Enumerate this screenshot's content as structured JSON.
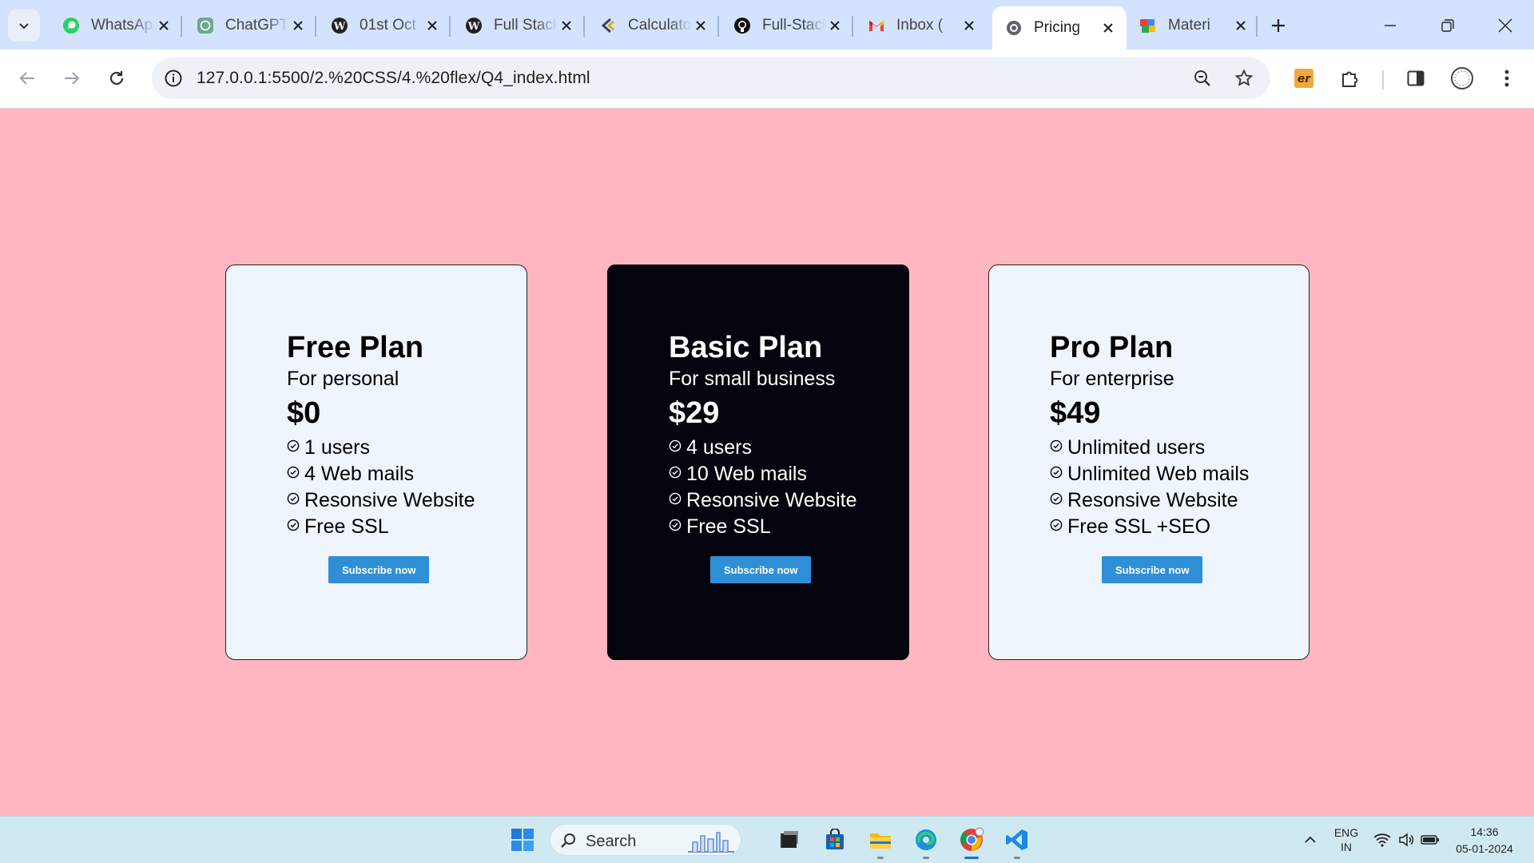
{
  "browser": {
    "tabs": [
      {
        "title": "WhatsApp",
        "icon": "whatsapp-icon",
        "active": false
      },
      {
        "title": "ChatGPT",
        "icon": "chatgpt-icon",
        "active": false
      },
      {
        "title": "01st Oct",
        "icon": "wordpress-icon",
        "active": false
      },
      {
        "title": "Full Stack",
        "icon": "wordpress-icon",
        "active": false
      },
      {
        "title": "Calculator",
        "icon": "calculator-icon",
        "active": false
      },
      {
        "title": "Full-Stack",
        "icon": "github-icon",
        "active": false
      },
      {
        "title": "Inbox (",
        "icon": "gmail-icon",
        "active": false
      },
      {
        "title": "Pricing",
        "icon": "globe-icon",
        "active": true
      },
      {
        "title": "Materi",
        "icon": "material-icon",
        "active": false
      }
    ],
    "url": "127.0.0.1:5500/2.%20CSS/4.%20flex/Q4_index.html",
    "extension_label": "er"
  },
  "plans": [
    {
      "name": "Free Plan",
      "subtitle": "For personal",
      "price": "$0",
      "features": [
        "1 users",
        "4 Web mails",
        "Resonsive Website",
        "Free SSL"
      ],
      "button": "Subscribe now",
      "theme": "light"
    },
    {
      "name": "Basic Plan",
      "subtitle": "For small business",
      "price": "$29",
      "features": [
        "4 users",
        "10 Web mails",
        "Resonsive Website",
        "Free SSL"
      ],
      "button": "Subscribe now",
      "theme": "dark"
    },
    {
      "name": "Pro Plan",
      "subtitle": "For enterprise",
      "price": "$49",
      "features": [
        "Unlimited users",
        "Unlimited Web mails",
        "Resonsive Website",
        "Free SSL +SEO"
      ],
      "button": "Subscribe now",
      "theme": "light"
    }
  ],
  "colors": {
    "page_background": "#ffb6c1",
    "card_light": "#eef5fd",
    "card_dark": "#03040e",
    "button": "#2f8fd6"
  },
  "taskbar": {
    "search_placeholder": "Search",
    "language": "ENG",
    "region": "IN",
    "time": "14:36",
    "date": "05-01-2024"
  }
}
